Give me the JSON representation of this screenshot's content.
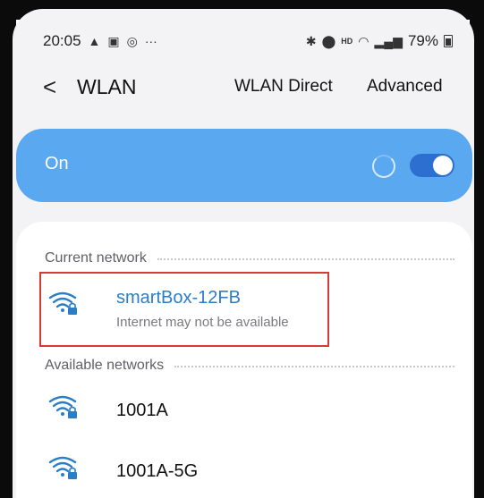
{
  "status_bar": {
    "time": "20:05",
    "left_icons": [
      "notification-icon",
      "gallery-icon",
      "sync-icon"
    ],
    "more": "···",
    "right_icons": [
      "bluetooth-icon",
      "location-icon",
      "hd-icon",
      "wifi-status-icon",
      "4g-signal-icon"
    ],
    "hd": "HD",
    "battery": "79%"
  },
  "header": {
    "back": "<",
    "title": "WLAN",
    "wlan_direct": "WLAN Direct",
    "advanced": "Advanced"
  },
  "toggle": {
    "label": "On",
    "enabled": true
  },
  "current_network": {
    "section_label": "Current network",
    "name": "smartBox-12FB",
    "status": "Internet may not be available",
    "secured": true
  },
  "available_networks": {
    "section_label": "Available networks",
    "items": [
      {
        "name": "1001A",
        "secured": true
      },
      {
        "name": "1001A-5G",
        "secured": true
      }
    ]
  },
  "colors": {
    "toggle_card": "#5aa8ef",
    "current_network_text": "#2a7ec8",
    "highlight": "#d83a3a"
  }
}
